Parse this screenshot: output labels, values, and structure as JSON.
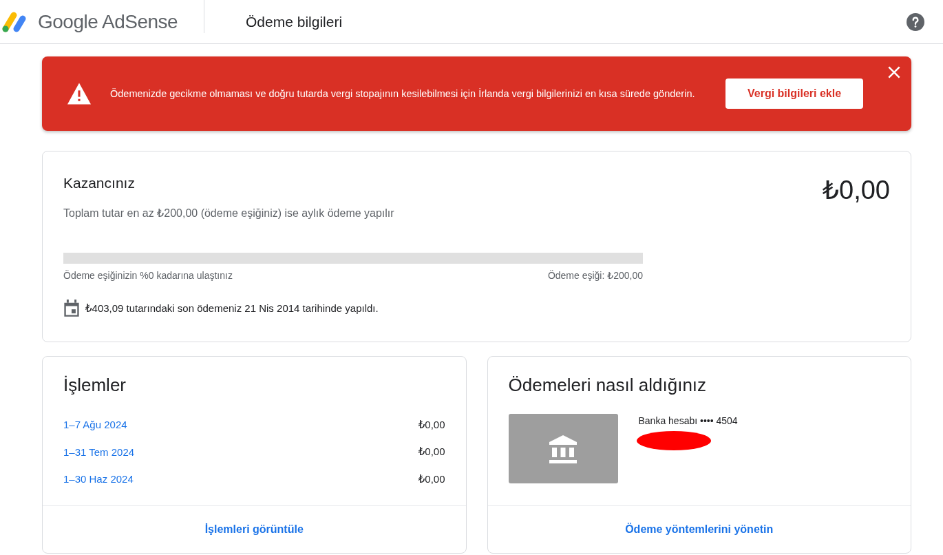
{
  "header": {
    "product": "Google AdSense",
    "page_title": "Ödeme bilgileri"
  },
  "alert": {
    "message": "Ödemenizde gecikme olmaması ve doğru tutarda vergi stopajının kesilebilmesi için İrlanda vergi bilgilerinizi en kısa sürede gönderin.",
    "button": "Vergi bilgileri ekle"
  },
  "earnings": {
    "title": "Kazancınız",
    "amount": "₺0,00",
    "subtitle": "Toplam tutar en az ₺200,00 (ödeme eşiğiniz) ise aylık ödeme yapılır",
    "progress": {
      "level": 0,
      "left_label": "Ödeme eşiğinizin %0 kadarına ulaştınız",
      "right_label": "Ödeme eşiği: ₺200,00"
    },
    "last_payment": "₺403,09 tutarındaki son ödemeniz 21 Nis 2014 tarihinde yapıldı."
  },
  "transactions": {
    "title": "İşlemler",
    "rows": [
      {
        "period": "1–7 Ağu 2024",
        "amount": "₺0,00"
      },
      {
        "period": "1–31 Tem 2024",
        "amount": "₺0,00"
      },
      {
        "period": "1–30 Haz 2024",
        "amount": "₺0,00"
      }
    ],
    "link": "İşlemleri görüntüle"
  },
  "payment_methods": {
    "title": "Ödemeleri nasıl aldığınız",
    "account": "Banka hesabı •••• 4504",
    "link": "Ödeme yöntemlerini yönetin"
  }
}
